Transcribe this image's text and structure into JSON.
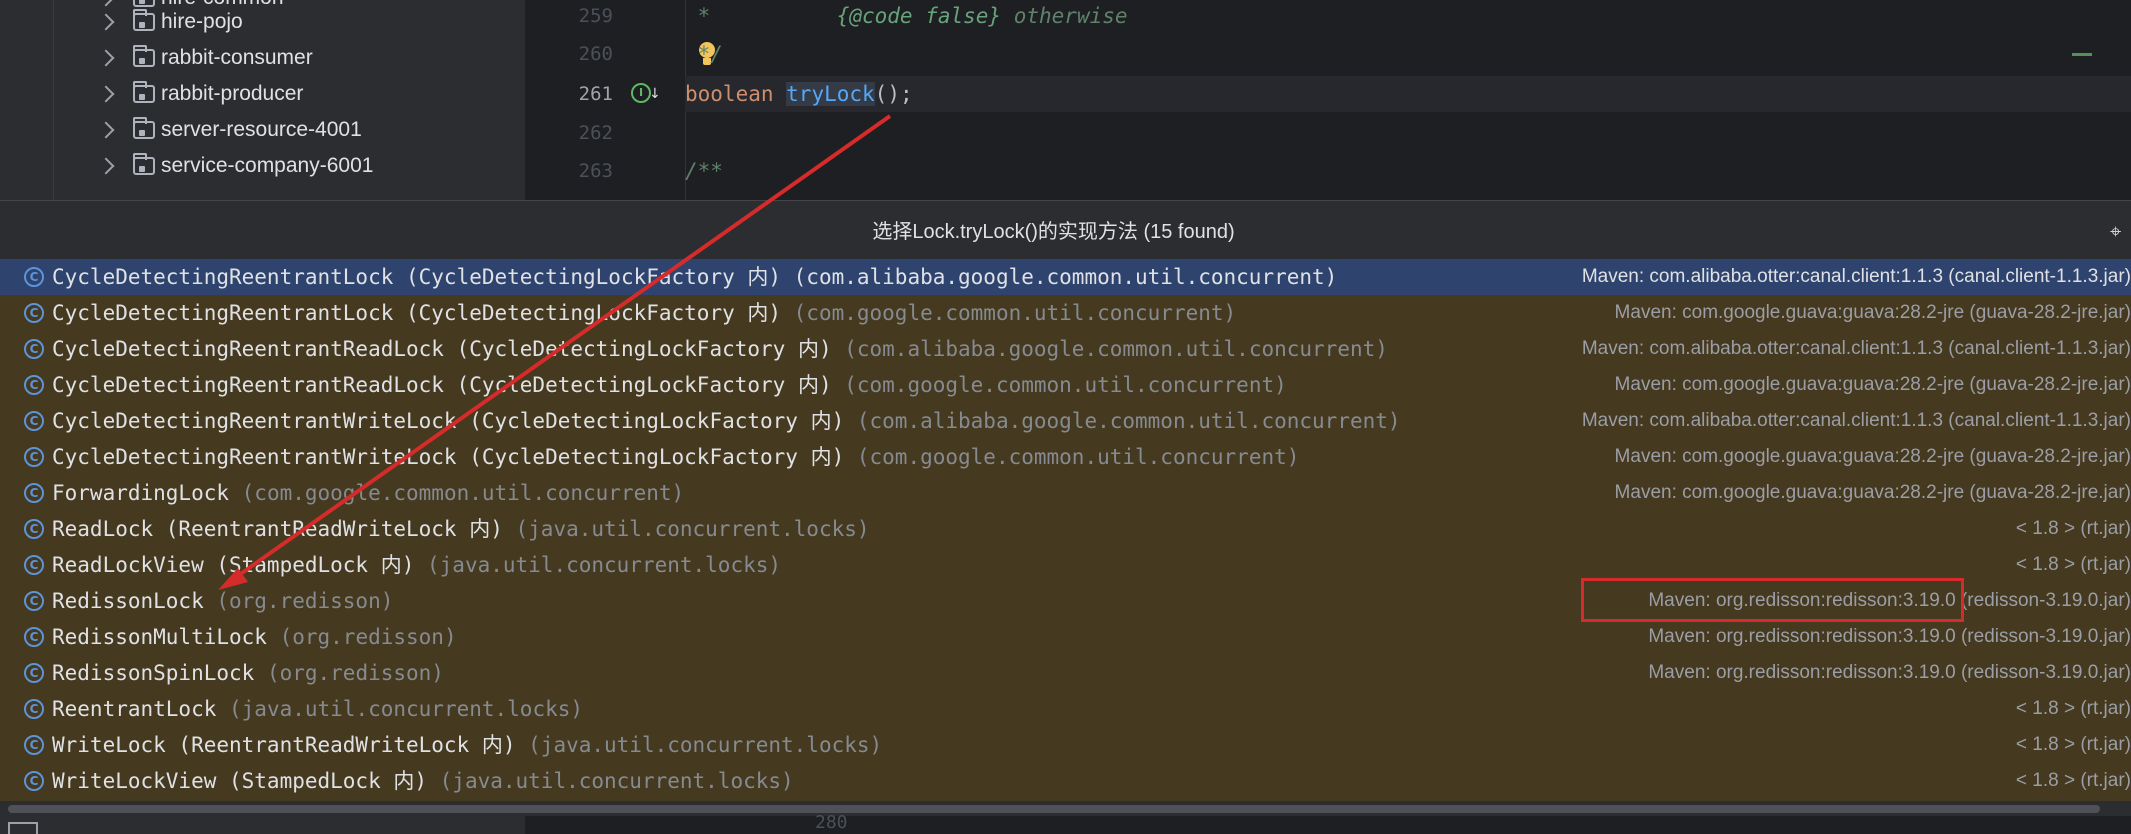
{
  "project_tree": {
    "items": [
      {
        "label": "hire-common"
      },
      {
        "label": "hire-pojo"
      },
      {
        "label": "rabbit-consumer"
      },
      {
        "label": "rabbit-producer"
      },
      {
        "label": "server-resource-4001"
      },
      {
        "label": "service-company-6001"
      }
    ]
  },
  "editor": {
    "lines": [
      {
        "num": "259",
        "comment": " *          ",
        "tag": "{@code false}",
        "rest": " otherwise"
      },
      {
        "num": "260",
        "comment": " */"
      },
      {
        "num": "261",
        "kw": "boolean ",
        "fn": "tryLock",
        "tail": "();"
      },
      {
        "num": "262"
      },
      {
        "num": "263",
        "comment": "/**"
      }
    ],
    "bottom_line_num": "280"
  },
  "popup": {
    "title": "选择Lock.tryLock()的实现方法 (15 found)",
    "results": [
      {
        "cls": "CycleDetectingReentrantLock (CycleDetectingLockFactory 内)",
        "pkg": " (com.alibaba.google.common.util.concurrent)",
        "source": "Maven: com.alibaba.otter:canal.client:1.1.3 (canal.client-1.1.3.jar)"
      },
      {
        "cls": "CycleDetectingReentrantLock (CycleDetectingLockFactory 内)",
        "pkg": " (com.google.common.util.concurrent)",
        "source": "Maven: com.google.guava:guava:28.2-jre (guava-28.2-jre.jar)"
      },
      {
        "cls": "CycleDetectingReentrantReadLock (CycleDetectingLockFactory 内)",
        "pkg": " (com.alibaba.google.common.util.concurrent)",
        "source": "Maven: com.alibaba.otter:canal.client:1.1.3 (canal.client-1.1.3.jar)"
      },
      {
        "cls": "CycleDetectingReentrantReadLock (CycleDetectingLockFactory 内)",
        "pkg": " (com.google.common.util.concurrent)",
        "source": "Maven: com.google.guava:guava:28.2-jre (guava-28.2-jre.jar)"
      },
      {
        "cls": "CycleDetectingReentrantWriteLock (CycleDetectingLockFactory 内)",
        "pkg": " (com.alibaba.google.common.util.concurrent)",
        "source": "Maven: com.alibaba.otter:canal.client:1.1.3 (canal.client-1.1.3.jar)"
      },
      {
        "cls": "CycleDetectingReentrantWriteLock (CycleDetectingLockFactory 内)",
        "pkg": " (com.google.common.util.concurrent)",
        "source": "Maven: com.google.guava:guava:28.2-jre (guava-28.2-jre.jar)"
      },
      {
        "cls": "ForwardingLock",
        "pkg": " (com.google.common.util.concurrent)",
        "source": "Maven: com.google.guava:guava:28.2-jre (guava-28.2-jre.jar)"
      },
      {
        "cls": "ReadLock (ReentrantReadWriteLock 内)",
        "pkg": " (java.util.concurrent.locks)",
        "source": "< 1.8 > (rt.jar)"
      },
      {
        "cls": "ReadLockView (StampedLock 内)",
        "pkg": " (java.util.concurrent.locks)",
        "source": "< 1.8 > (rt.jar)"
      },
      {
        "cls": "RedissonLock",
        "pkg": " (org.redisson)",
        "source": "Maven: org.redisson:redisson:3.19.0 (redisson-3.19.0.jar)"
      },
      {
        "cls": "RedissonMultiLock",
        "pkg": " (org.redisson)",
        "source": "Maven: org.redisson:redisson:3.19.0 (redisson-3.19.0.jar)"
      },
      {
        "cls": "RedissonSpinLock",
        "pkg": " (org.redisson)",
        "source": "Maven: org.redisson:redisson:3.19.0 (redisson-3.19.0.jar)"
      },
      {
        "cls": "ReentrantLock",
        "pkg": " (java.util.concurrent.locks)",
        "source": "< 1.8 > (rt.jar)"
      },
      {
        "cls": "WriteLock (ReentrantReadWriteLock 内)",
        "pkg": " (java.util.concurrent.locks)",
        "source": "< 1.8 > (rt.jar)"
      },
      {
        "cls": "WriteLockView (StampedLock 内)",
        "pkg": " (java.util.concurrent.locks)",
        "source": "< 1.8 > (rt.jar)"
      }
    ],
    "selected_index": 0
  },
  "icons": {
    "class_icon": "class-icon",
    "pin_icon": "pin-icon",
    "folder_icon": "folder-icon",
    "bulb_icon": "lightbulb-icon",
    "implementation_icon": "implemented-method-icon"
  },
  "colors": {
    "annotation": "#d52b2b",
    "popup_background": "#45391f",
    "selection": "#2e436e"
  }
}
